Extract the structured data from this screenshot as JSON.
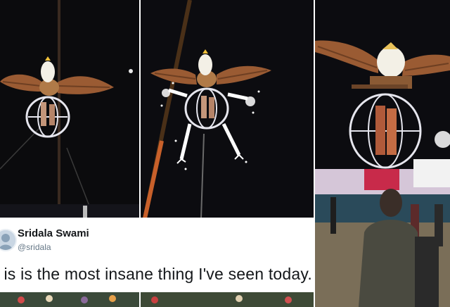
{
  "tweet": {
    "display_name": "Sridala Swami",
    "handle": "@sridala",
    "text": "is is the most insane thing I've seen today."
  },
  "panels": [
    {
      "name": "panel-left",
      "subject": "eagle-float-with-cage"
    },
    {
      "name": "panel-middle",
      "subject": "eagle-float-with-fireworks"
    },
    {
      "name": "panel-right",
      "subject": "eagle-float-over-crowd"
    }
  ],
  "colors": {
    "night_sky": "#0b0b0d",
    "eagle_wing": "#9a5b33",
    "eagle_head": "#f3f0e6",
    "cage_ring": "#e6e6ee",
    "sparks": "#ffffff",
    "tweet_text": "#14171a",
    "handle_text": "#657786"
  }
}
